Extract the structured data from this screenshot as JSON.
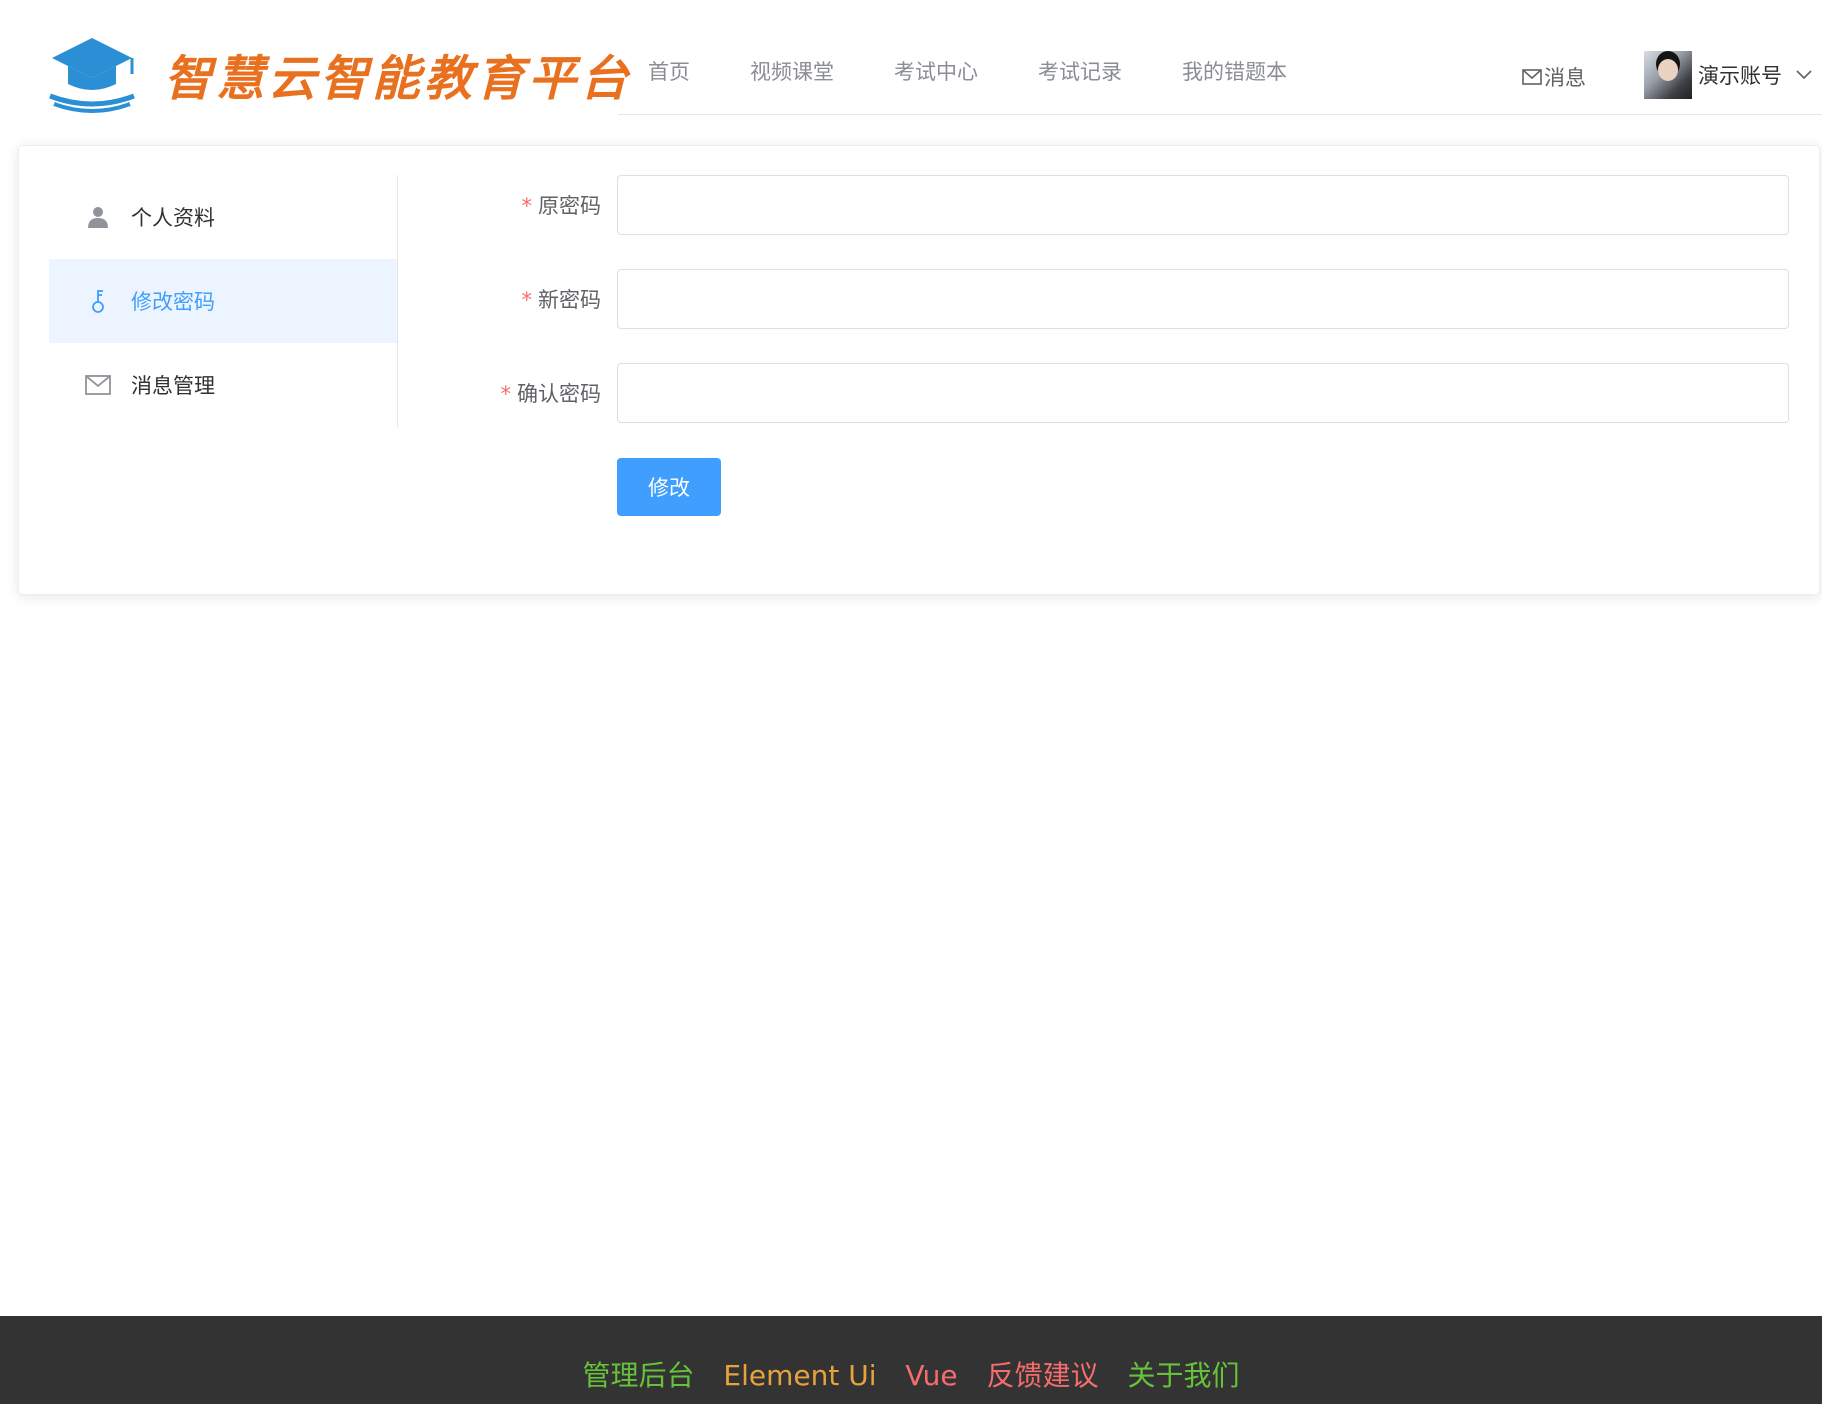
{
  "header": {
    "logo_title": "智慧云智能教育平台",
    "nav": [
      "首页",
      "视频课堂",
      "考试中心",
      "考试记录",
      "我的错题本"
    ],
    "message_label": "消息",
    "user_name": "演示账号"
  },
  "sidebar": {
    "items": [
      {
        "label": "个人资料",
        "icon": "user-icon"
      },
      {
        "label": "修改密码",
        "icon": "key-icon"
      },
      {
        "label": "消息管理",
        "icon": "envelope-icon"
      }
    ],
    "active_index": 1
  },
  "form": {
    "fields": [
      {
        "label": "原密码",
        "required_mark": "*",
        "value": ""
      },
      {
        "label": "新密码",
        "required_mark": "*",
        "value": ""
      },
      {
        "label": "确认密码",
        "required_mark": "*",
        "value": ""
      }
    ],
    "submit_label": "修改"
  },
  "footer": {
    "links": [
      {
        "label": "管理后台",
        "color": "#67c23a"
      },
      {
        "label": "Element Ui",
        "color": "#e6a23c"
      },
      {
        "label": "Vue",
        "color": "#f56c6c"
      },
      {
        "label": "反馈建议",
        "color": "#f56c6c"
      },
      {
        "label": "关于我们",
        "color": "#67c23a"
      }
    ]
  },
  "colors": {
    "primary": "#409eff",
    "logo_text": "#e8701f",
    "logo_icon": "#2b8fd6",
    "footer_bg": "#333333"
  }
}
